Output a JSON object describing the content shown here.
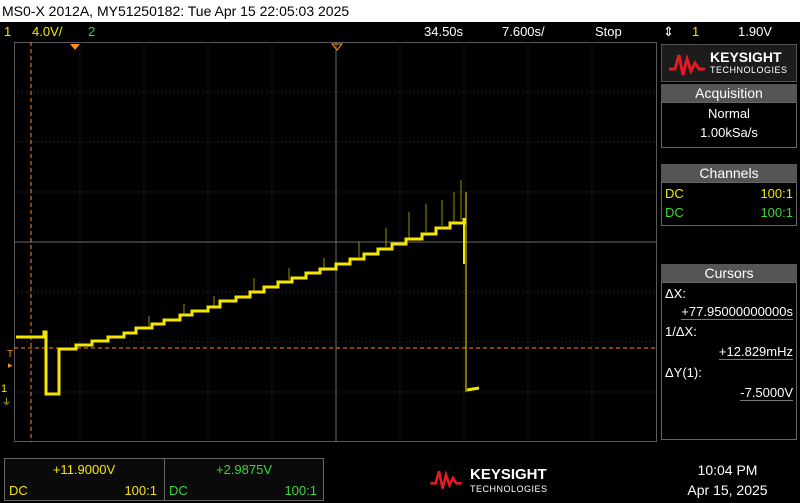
{
  "title": "MS0-X 2012A, MY51250182: Tue Apr 15 22:05:03 2025",
  "status": {
    "ch1_num": "1",
    "ch1_scale": "4.0V/",
    "ch2_num": "2",
    "time_pos": "34.50s",
    "time_scale": "7.600s/",
    "run_state": "Stop",
    "trig_ch": "1",
    "trig_level": "1.90V"
  },
  "colors": {
    "ch1": "#f5e600",
    "ch2": "#3ad63a",
    "trigger": "#ff8c1a"
  },
  "markers": {
    "trigger": "T",
    "ground": "1",
    "ch1": "1"
  },
  "logo": {
    "name": "KEYSIGHT",
    "sub": "TECHNOLOGIES"
  },
  "acquisition": {
    "header": "Acquisition",
    "mode": "Normal",
    "rate": "1.00kSa/s"
  },
  "channels": {
    "header": "Channels",
    "items": [
      {
        "coupling": "DC",
        "probe": "100:1"
      },
      {
        "coupling": "DC",
        "probe": "100:1"
      }
    ]
  },
  "cursors": {
    "header": "Cursors",
    "dx_label": "ΔX:",
    "dx_value": "+77.95000000000s",
    "inv_dx_label": "1/ΔX:",
    "inv_dx_value": "+12.829mHz",
    "dy_label": "ΔY(1):",
    "dy_value": "-7.5000V"
  },
  "measurements": [
    {
      "value": "+11.9000V",
      "coupling": "DC",
      "probe": "100:1"
    },
    {
      "value": "+2.9875V",
      "coupling": "DC",
      "probe": "100:1"
    }
  ],
  "clock": {
    "time": "10:04 PM",
    "date": "Apr 15, 2025"
  }
}
